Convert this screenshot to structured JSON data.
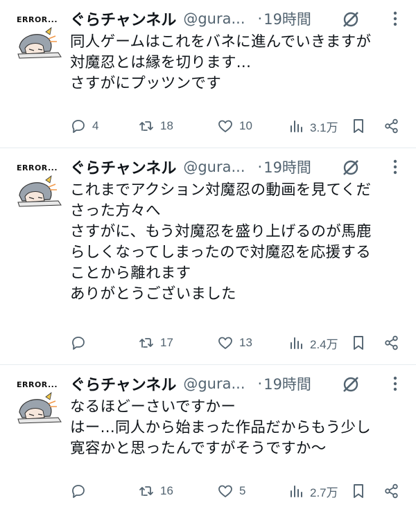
{
  "avatar_text": "ERROR...",
  "tweets": [
    {
      "name": "ぐらチャンネル",
      "handle": "@gura...",
      "dot": "·",
      "time": "19時間",
      "lines": [
        "同人ゲームはこれをバネに進んでいきますが",
        "対魔忍とは縁を切ります...",
        "さすがにプッツンです"
      ],
      "replies": "4",
      "retweets": "18",
      "likes": "10",
      "views": "3.1万"
    },
    {
      "name": "ぐらチャンネル",
      "handle": "@gura...",
      "dot": "·",
      "time": "19時間",
      "lines": [
        "これまでアクション対魔忍の動画を見てくだ",
        "さった方々へ",
        "さすがに、もう対魔忍を盛り上げるのが馬鹿",
        "らしくなってしまったので対魔忍を応援する",
        "ことから離れます",
        "ありがとうございました"
      ],
      "replies": "",
      "retweets": "17",
      "likes": "13",
      "views": "2.4万"
    },
    {
      "name": "ぐらチャンネル",
      "handle": "@gura...",
      "dot": "·",
      "time": "19時間",
      "lines": [
        "なるほどーさいですかー",
        "はー...同人から始まった作品だからもう少し",
        "寛容かと思ったんですがそうですか～"
      ],
      "replies": "",
      "retweets": "16",
      "likes": "5",
      "views": "2.7万"
    }
  ],
  "colors": {
    "text": "#0f1419",
    "muted": "#536471",
    "divider": "#e6ecf0"
  },
  "icons": [
    "reply-icon",
    "retweet-icon",
    "like-icon",
    "views-icon",
    "bookmark-icon",
    "share-icon",
    "grok-icon",
    "more-icon"
  ]
}
